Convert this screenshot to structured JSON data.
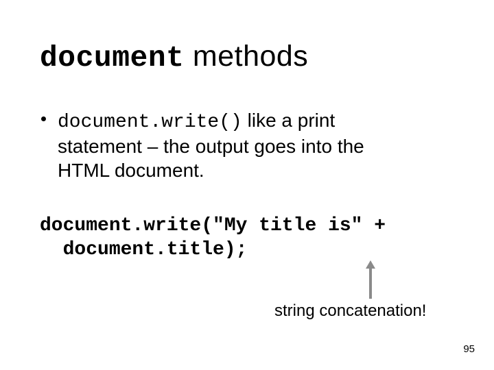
{
  "title": {
    "mono": "document",
    "rest": " methods"
  },
  "bullet": {
    "mono": "document.write()",
    "rest_line1": " like a print",
    "line2": "statement – the output goes into the",
    "line3": "HTML document."
  },
  "code": {
    "line1": "document.write(\"My title is\" +",
    "line2": "  document.title);"
  },
  "annotation": "string concatenation!",
  "page_number": "95"
}
